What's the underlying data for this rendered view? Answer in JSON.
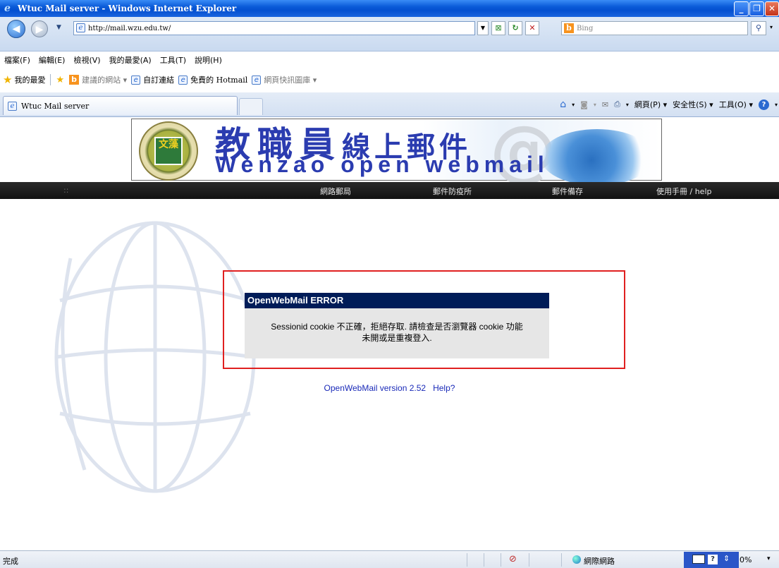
{
  "window": {
    "title": "Wtuc Mail server - Windows Internet Explorer",
    "buttons": {
      "minimize": "_",
      "restore": "❐",
      "close": "✕"
    }
  },
  "address_bar": {
    "url": "http://mail.wzu.edu.tw/",
    "search_placeholder": "Bing"
  },
  "menu": {
    "items": [
      "檔案(F)",
      "編輯(E)",
      "檢視(V)",
      "我的最愛(A)",
      "工具(T)",
      "說明(H)"
    ]
  },
  "favorites_bar": {
    "favorites_label": "我的最愛",
    "links": [
      "建議的網站 ▾",
      "自訂連結",
      "免費的 Hotmail",
      "網頁快訊圖庫 ▾"
    ]
  },
  "tabs": {
    "active_tab_title": "Wtuc Mail server"
  },
  "command_bar": {
    "items": [
      "網頁(P) ▾",
      "安全性(S) ▾",
      "工具(O) ▾"
    ]
  },
  "banner": {
    "title_zh_big": "教職員",
    "title_zh_small": "線上郵件",
    "title_en": "Wenzao open webmail",
    "logo_text": "文藻"
  },
  "site_nav": {
    "dots": "::",
    "items": [
      "網路郵局",
      "郵件防疫所",
      "郵件備存",
      "使用手冊 / help"
    ]
  },
  "error": {
    "title": "OpenWebMail ERROR",
    "message_line1": "Sessionid cookie 不正確，拒絕存取. 請檢查是否瀏覽器 cookie 功能",
    "message_line2": "未開或是重複登入."
  },
  "footer": {
    "version": "OpenWebMail version 2.52",
    "help": "Help?"
  },
  "status_bar": {
    "status": "完成",
    "zone": "網際網路",
    "zoom": "0%"
  }
}
